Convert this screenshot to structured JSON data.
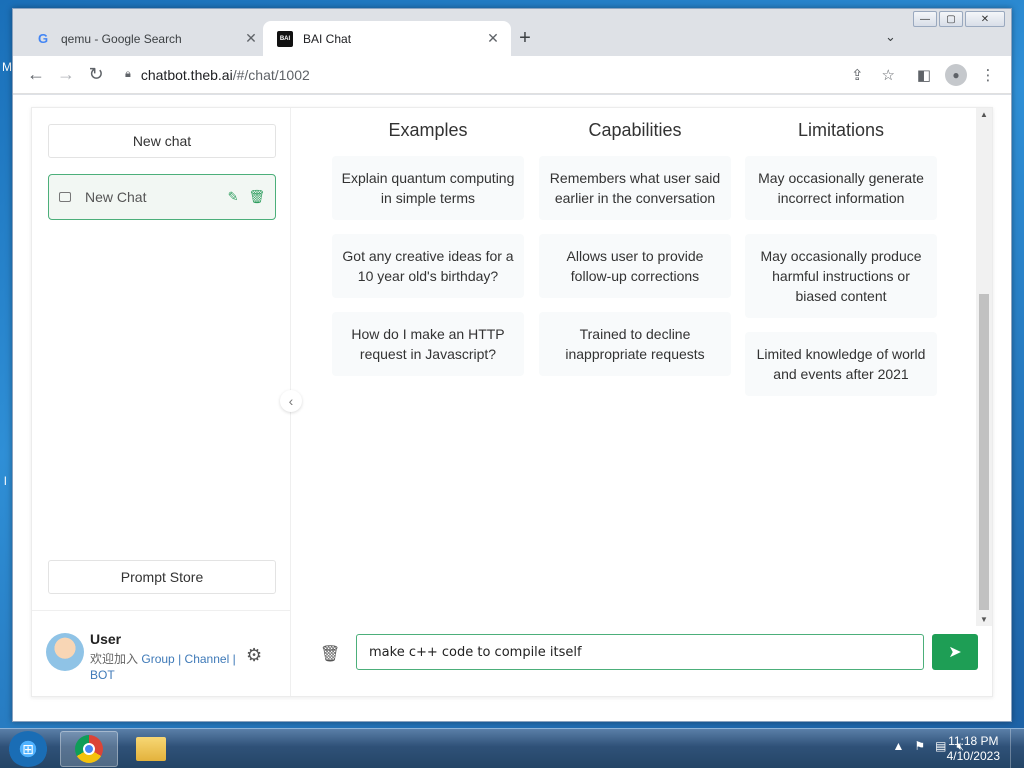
{
  "desktop": {
    "left_mark_1": "M",
    "left_mark_2": "l"
  },
  "browser": {
    "tabs": [
      {
        "title": "qemu - Google Search",
        "favicon": "G"
      },
      {
        "title": "BAI Chat",
        "favicon": "BAI"
      }
    ],
    "new_tab": "+",
    "tab_search": "⌄",
    "window_controls": {
      "minimize": "—",
      "maximize": "▢",
      "close": "✕"
    },
    "url_host": "chatbot.theb.ai",
    "url_path": "/#/chat/1002"
  },
  "sidebar": {
    "new_chat_button": "New chat",
    "chat_items": [
      {
        "label": "New Chat"
      }
    ],
    "prompt_store_button": "Prompt Store",
    "user": {
      "name": "User",
      "welcome_prefix": "欢迎加入",
      "link_group": "Group",
      "sep1": "|",
      "link_channel": "Channel",
      "sep2": "|",
      "link_bot": "BOT"
    }
  },
  "main": {
    "columns": [
      {
        "heading": "Examples",
        "items": [
          "Explain quantum computing in simple terms",
          "Got any creative ideas for a 10 year old's birthday?",
          "How do I make an HTTP request in Javascript?"
        ]
      },
      {
        "heading": "Capabilities",
        "items": [
          "Remembers what user said earlier in the conversation",
          "Allows user to provide follow-up corrections",
          "Trained to decline inappropriate requests"
        ]
      },
      {
        "heading": "Limitations",
        "items": [
          "May occasionally generate incorrect information",
          "May occasionally produce harmful instructions or biased content",
          "Limited knowledge of world and events after 2021"
        ]
      }
    ],
    "input_value": "make c++ code to compile itself"
  },
  "taskbar": {
    "time": "11:18 PM",
    "date": "4/10/2023"
  },
  "icons": {
    "back": "arrow-left-icon",
    "forward": "arrow-right-icon",
    "reload": "reload-icon",
    "lock": "lock-icon",
    "share": "share-icon",
    "star": "star-icon",
    "sidepanel": "side-panel-icon",
    "profile": "profile-icon",
    "menu": "kebab-menu-icon",
    "gear": "gear-icon",
    "trash": "trash-icon",
    "send": "send-icon",
    "edit": "edit-icon",
    "chat": "chat-bubble-icon",
    "collapse": "chevron-left-icon"
  },
  "colors": {
    "accent": "#1e9e55",
    "link": "#3f7ab8",
    "chat_border": "#4caf7a"
  }
}
